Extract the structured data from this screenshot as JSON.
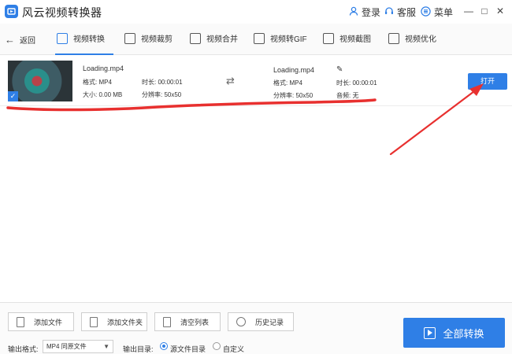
{
  "app": {
    "title": "风云视频转换器",
    "login_label": "登录",
    "service_label": "客服",
    "menu_label": "菜单",
    "minimize_glyph": "—",
    "close_glyph": "✕",
    "maximize_glyph": "□"
  },
  "nav": {
    "back_label": "返回",
    "tabs": [
      {
        "label": "视频转换",
        "icon": "video-convert-icon",
        "active": true
      },
      {
        "label": "视频裁剪",
        "icon": "video-crop-icon"
      },
      {
        "label": "视频合并",
        "icon": "video-merge-icon"
      },
      {
        "label": "视频转GIF",
        "icon": "gif-icon"
      },
      {
        "label": "视频截图",
        "icon": "screenshot-icon"
      },
      {
        "label": "视频优化",
        "icon": "optimize-icon"
      }
    ]
  },
  "file": {
    "source": {
      "name": "Loading.mp4",
      "format": "格式: MP4",
      "size": "大小: 0.00 MB",
      "duration": "时长: 00:00:01",
      "resolution": "分辨率: 50x50"
    },
    "output": {
      "name": "Loading.mp4",
      "format": "格式: MP4",
      "resolution": "分辨率: 50x50",
      "duration": "时长: 00:00:01",
      "audio": "音频: 无"
    },
    "open_label": "打开",
    "thumb_check": "✓"
  },
  "toolbar": {
    "add_file": "添加文件",
    "add_folder": "添加文件夹",
    "clear_list": "清空列表",
    "history": "历史记录"
  },
  "output": {
    "format_label": "输出格式:",
    "format_value": "MP4 同原文件",
    "dir_label": "输出目录:",
    "dir_option_source": "源文件目录",
    "dir_option_custom": "自定义",
    "selected_dir": "源文件目录"
  },
  "convert_all_label": "全部转换",
  "colors": {
    "accent": "#2f7fe6",
    "annotation": "#e8302f"
  }
}
